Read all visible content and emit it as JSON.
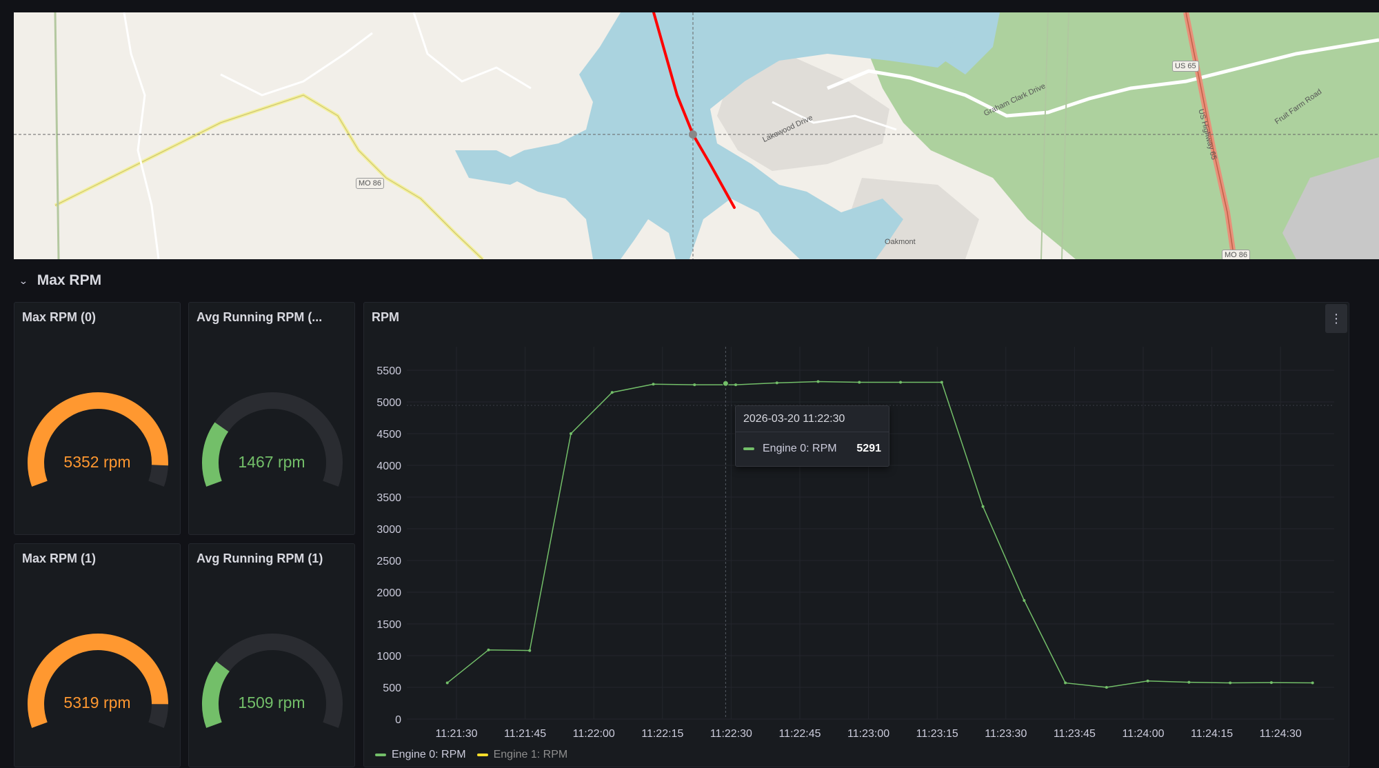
{
  "map": {
    "road_labels": [
      "MO 86",
      "US 65",
      "Graham Clark Drive",
      "Lakewood Drive",
      "US Highway 65",
      "Fruit Farm Road",
      "Oakmont",
      "MO 86"
    ]
  },
  "row": {
    "title": "Max RPM"
  },
  "gauges": [
    {
      "title": "Max RPM (0)",
      "value": 5352,
      "display": "5352 rpm",
      "color": "#ff9830",
      "fraction": 0.92
    },
    {
      "title": "Avg Running RPM (...",
      "value": 1467,
      "display": "1467 rpm",
      "color": "#73bf69",
      "fraction": 0.25
    },
    {
      "title": "Max RPM (1)",
      "value": 5319,
      "display": "5319 rpm",
      "color": "#ff9830",
      "fraction": 0.91
    },
    {
      "title": "Avg Running RPM (1)",
      "value": 1509,
      "display": "1509 rpm",
      "color": "#73bf69",
      "fraction": 0.26
    }
  ],
  "rpm_panel": {
    "title": "RPM",
    "menu_icon": "vertical-dots-icon"
  },
  "tooltip": {
    "time": "2026-03-20 11:22:30",
    "series": "Engine 0: RPM",
    "value": "5291"
  },
  "legend": [
    {
      "name": "Engine 0: RPM",
      "color": "#73bf69"
    },
    {
      "name": "Engine 1: RPM",
      "color": "#fade2a"
    }
  ],
  "chart_data": {
    "type": "line",
    "title": "RPM",
    "ylim": [
      0,
      5500
    ],
    "y_ticks": [
      0,
      500,
      1000,
      1500,
      2000,
      2500,
      3000,
      3500,
      4000,
      4500,
      5000,
      5500
    ],
    "x_ticks": [
      "11:21:30",
      "11:21:45",
      "11:22:00",
      "11:22:15",
      "11:22:30",
      "11:22:45",
      "11:23:00",
      "11:23:15",
      "11:23:30",
      "11:23:45",
      "11:24:00",
      "11:24:15",
      "11:24:30"
    ],
    "grid": true,
    "legend_position": "bottom-left",
    "series": [
      {
        "name": "Engine 0: RPM",
        "color": "#73bf69",
        "x": [
          "11:21:28",
          "11:21:37",
          "11:21:46",
          "11:21:55",
          "11:22:04",
          "11:22:13",
          "11:22:22",
          "11:22:31",
          "11:22:40",
          "11:22:49",
          "11:22:58",
          "11:23:07",
          "11:23:16",
          "11:23:25",
          "11:23:34",
          "11:23:43",
          "11:23:52",
          "11:24:01",
          "11:24:10",
          "11:24:19",
          "11:24:28",
          "11:24:37"
        ],
        "values": [
          570,
          1090,
          1080,
          4500,
          5150,
          5280,
          5270,
          5270,
          5300,
          5320,
          5310,
          5310,
          5310,
          3350,
          1870,
          570,
          500,
          600,
          580,
          570,
          575,
          570
        ]
      }
    ]
  }
}
